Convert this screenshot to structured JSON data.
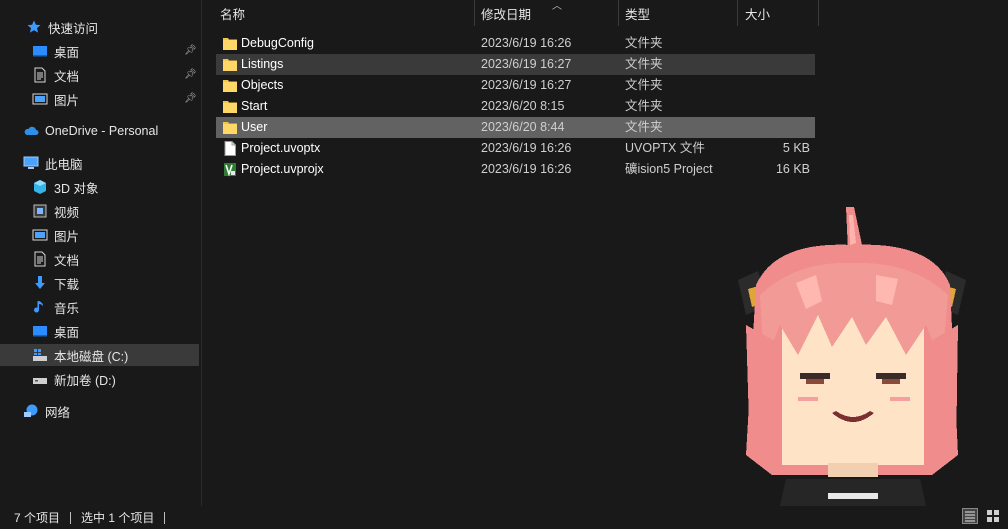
{
  "nav": {
    "quick_access": "快速访问",
    "quick_items": [
      "桌面",
      "文档",
      "图片"
    ],
    "onedrive": "OneDrive - Personal",
    "this_pc": "此电脑",
    "pc_items": [
      "3D 对象",
      "视频",
      "图片",
      "文档",
      "下载",
      "音乐",
      "桌面",
      "本地磁盘 (C:)",
      "新加卷 (D:)"
    ],
    "network": "网络"
  },
  "columns": {
    "name": "名称",
    "date": "修改日期",
    "type": "类型",
    "size": "大小"
  },
  "files": [
    {
      "name": "DebugConfig",
      "date": "2023/6/19 16:26",
      "type": "文件夹",
      "size": "",
      "icon": "folder-icon"
    },
    {
      "name": "Listings",
      "date": "2023/6/19 16:27",
      "type": "文件夹",
      "size": "",
      "icon": "folder-icon"
    },
    {
      "name": "Objects",
      "date": "2023/6/19 16:27",
      "type": "文件夹",
      "size": "",
      "icon": "folder-icon"
    },
    {
      "name": "Start",
      "date": "2023/6/20 8:15",
      "type": "文件夹",
      "size": "",
      "icon": "folder-icon"
    },
    {
      "name": "User",
      "date": "2023/6/20 8:44",
      "type": "文件夹",
      "size": "",
      "icon": "folder-icon"
    },
    {
      "name": "Project.uvoptx",
      "date": "2023/6/19 16:26",
      "type": "UVOPTX 文件",
      "size": "5 KB",
      "icon": "file-icon"
    },
    {
      "name": "Project.uvprojx",
      "date": "2023/6/19 16:26",
      "type": "礦ision5 Project",
      "size": "16 KB",
      "icon": "keil-project-icon"
    }
  ],
  "status": {
    "count": "7 个项目",
    "selected": "选中 1 个项目"
  },
  "colors": {
    "background": "#191919",
    "selected_row": "#626262",
    "hover_row": "#3a3a3a",
    "folder": "#f4c54a"
  }
}
